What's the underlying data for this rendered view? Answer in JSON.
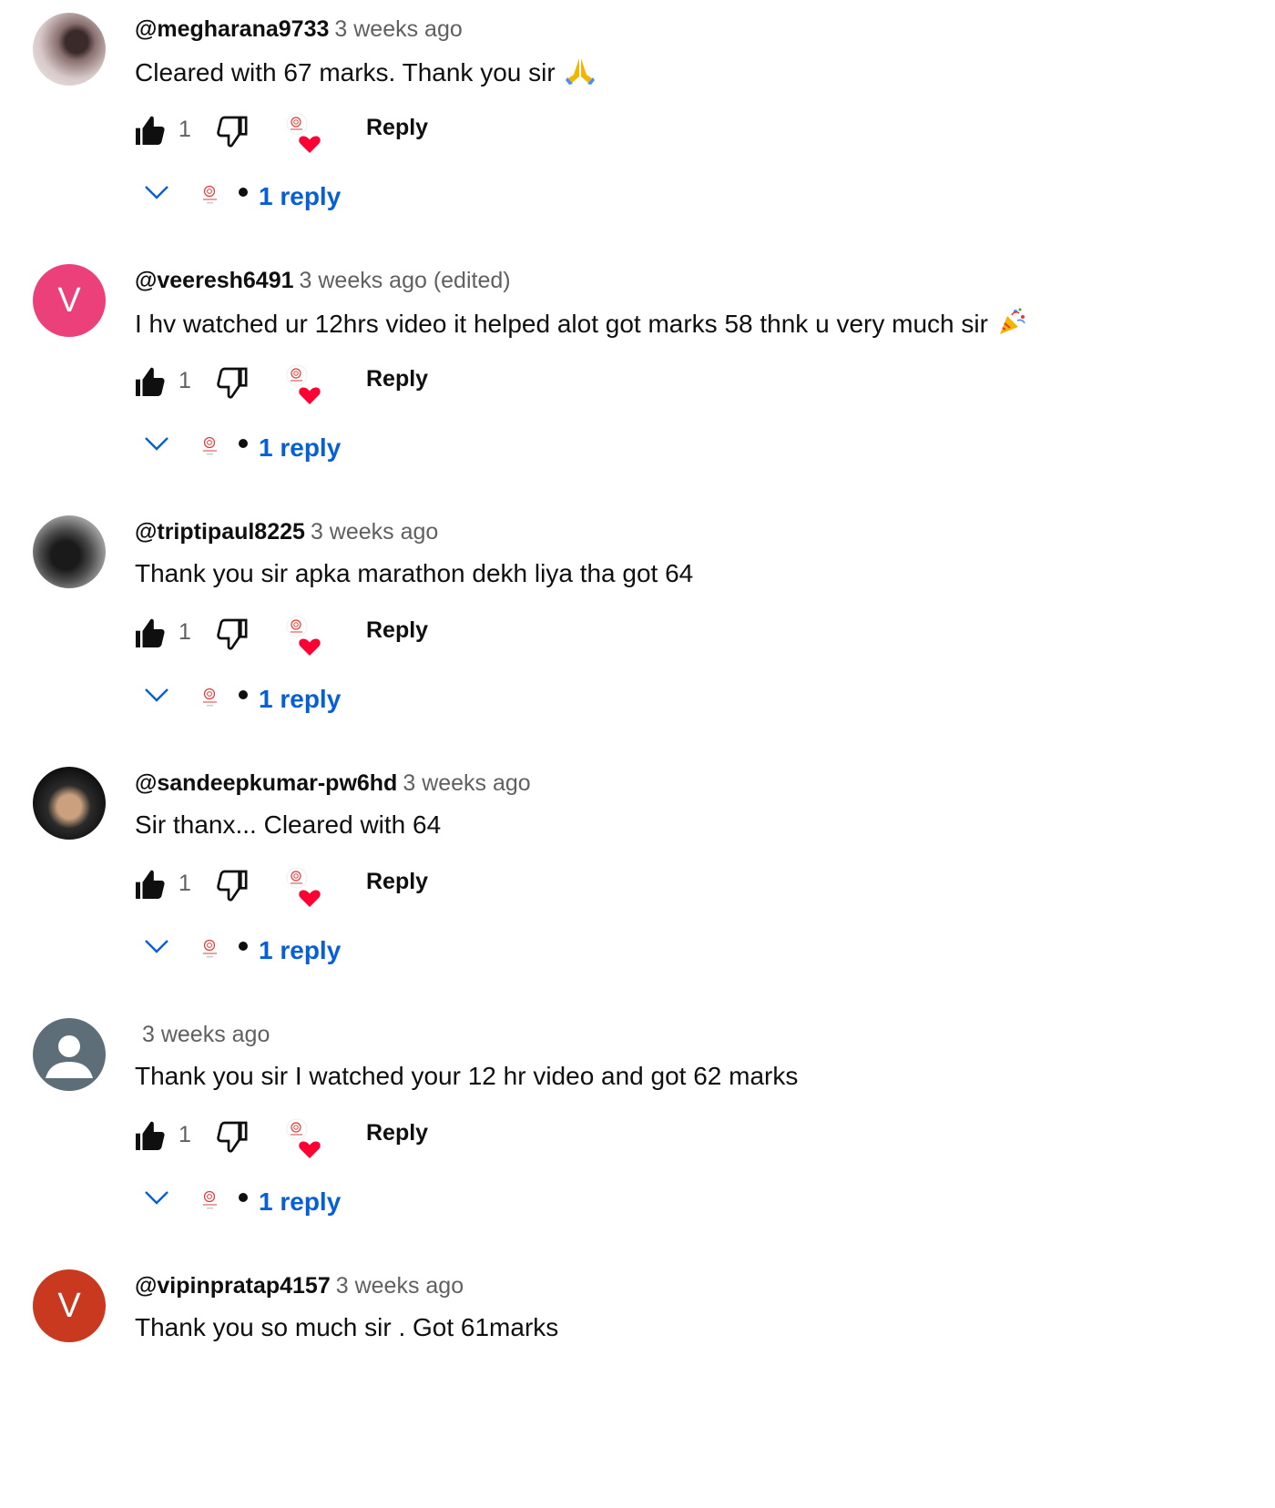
{
  "comments": [
    {
      "author": "@megharana9733",
      "time": "3 weeks ago",
      "text": "Cleared with 67 marks. Thank you sir",
      "emoji": "folded-hands",
      "likes": "1",
      "reply_label": "Reply",
      "replies_label": "1 reply",
      "avatar_style": "photo1",
      "avatar_letter": ""
    },
    {
      "author": "@veeresh6491",
      "time": "3 weeks ago (edited)",
      "text": "I hv watched ur 12hrs video it helped alot got marks 58 thnk u very much sir",
      "emoji": "party-popper",
      "likes": "1",
      "reply_label": "Reply",
      "replies_label": "1 reply",
      "avatar_style": "letter-pink",
      "avatar_letter": "V"
    },
    {
      "author": "@triptipaul8225",
      "time": "3 weeks ago",
      "text": "Thank you sir apka marathon dekh liya tha got 64",
      "emoji": "",
      "likes": "1",
      "reply_label": "Reply",
      "replies_label": "1 reply",
      "avatar_style": "photo2",
      "avatar_letter": ""
    },
    {
      "author": "@sandeepkumar-pw6hd",
      "time": "3 weeks ago",
      "text": "Sir thanx... Cleared with 64",
      "emoji": "",
      "likes": "1",
      "reply_label": "Reply",
      "replies_label": "1 reply",
      "avatar_style": "photo3",
      "avatar_letter": ""
    },
    {
      "author": "",
      "time": "3 weeks ago",
      "text": "Thank you sir I watched your 12 hr video and got 62 marks",
      "emoji": "",
      "likes": "1",
      "reply_label": "Reply",
      "replies_label": "1 reply",
      "avatar_style": "default",
      "avatar_letter": ""
    },
    {
      "author": "@vipinpratap4157",
      "time": "3 weeks ago",
      "text": "Thank you so much sir . Got 61marks",
      "emoji": "",
      "likes": "",
      "reply_label": "",
      "replies_label": "",
      "avatar_style": "letter-red",
      "avatar_letter": "V"
    }
  ],
  "icons": {
    "like": "thumbs-up-icon",
    "dislike": "thumbs-down-icon",
    "creator_heart": "creator-heart-icon",
    "expand": "chevron-down-icon"
  },
  "colors": {
    "link_blue": "#065fd4",
    "heart_red": "#ff0033",
    "secondary_text": "#606060"
  }
}
